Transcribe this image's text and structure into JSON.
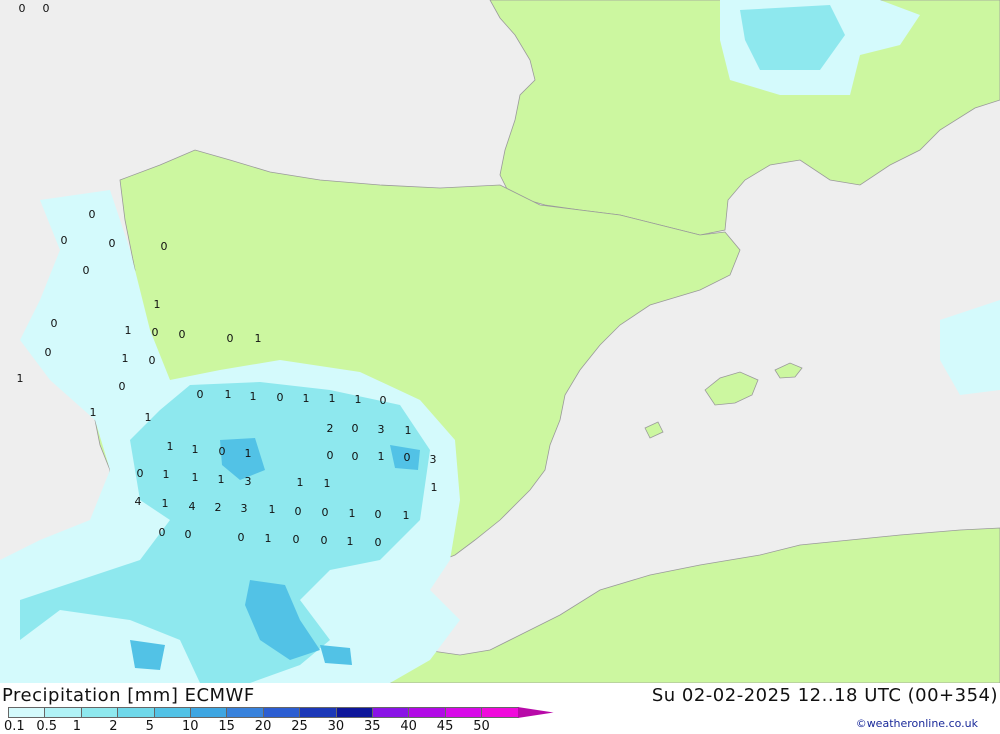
{
  "header": {
    "title": "Precipitation [mm] ECMWF",
    "date": "Su 02-02-2025 12..18 UTC (00+354)",
    "credit": "©weatheronline.co.uk"
  },
  "legend": {
    "labels": [
      "0.1",
      "0.5",
      "1",
      "2",
      "5",
      "10",
      "15",
      "20",
      "25",
      "30",
      "35",
      "40",
      "45",
      "50"
    ],
    "colors": [
      "#d4fafc",
      "#b0f2f6",
      "#8ee8ee",
      "#6fd8ea",
      "#52c2e6",
      "#3ea6e2",
      "#3882dc",
      "#2c5ed2",
      "#1c38b8",
      "#0e169a",
      "#8a14e6",
      "#b20ae6",
      "#d80ae8",
      "#f00adc",
      "#b80aa8"
    ]
  },
  "map": {
    "land_color": "#ccf7a0",
    "sea_color": "#eeeeee",
    "values": [
      {
        "v": "0"
      },
      {
        "v": "0"
      },
      {
        "v": "0"
      },
      {
        "v": "0"
      },
      {
        "v": "0"
      },
      {
        "v": "0"
      },
      {
        "v": "0"
      },
      {
        "v": "1"
      },
      {
        "v": "1"
      },
      {
        "v": "0"
      },
      {
        "v": "0"
      },
      {
        "v": "0"
      },
      {
        "v": "1"
      },
      {
        "v": "0"
      },
      {
        "v": "0"
      },
      {
        "v": "1"
      },
      {
        "v": "0"
      },
      {
        "v": "1"
      },
      {
        "v": "0"
      },
      {
        "v": "1"
      },
      {
        "v": "1"
      },
      {
        "v": "0"
      },
      {
        "v": "1"
      },
      {
        "v": "1"
      },
      {
        "v": "0"
      },
      {
        "v": "1"
      },
      {
        "v": "1"
      },
      {
        "v": "1"
      },
      {
        "v": "0"
      },
      {
        "v": "2"
      },
      {
        "v": "0"
      },
      {
        "v": "3"
      },
      {
        "v": "1"
      },
      {
        "v": "1"
      },
      {
        "v": "1"
      },
      {
        "v": "0"
      },
      {
        "v": "1"
      },
      {
        "v": "0"
      },
      {
        "v": "0"
      },
      {
        "v": "1"
      },
      {
        "v": "0"
      },
      {
        "v": "3"
      },
      {
        "v": "0"
      },
      {
        "v": "1"
      },
      {
        "v": "1"
      },
      {
        "v": "1"
      },
      {
        "v": "3"
      },
      {
        "v": "1"
      },
      {
        "v": "1"
      },
      {
        "v": "1"
      },
      {
        "v": "4"
      },
      {
        "v": "1"
      },
      {
        "v": "4"
      },
      {
        "v": "2"
      },
      {
        "v": "3"
      },
      {
        "v": "1"
      },
      {
        "v": "0"
      },
      {
        "v": "0"
      },
      {
        "v": "1"
      },
      {
        "v": "0"
      },
      {
        "v": "1"
      },
      {
        "v": "0"
      },
      {
        "v": "0"
      },
      {
        "v": "0"
      },
      {
        "v": "1"
      },
      {
        "v": "0"
      },
      {
        "v": "0"
      },
      {
        "v": "1"
      },
      {
        "v": "0"
      }
    ]
  }
}
